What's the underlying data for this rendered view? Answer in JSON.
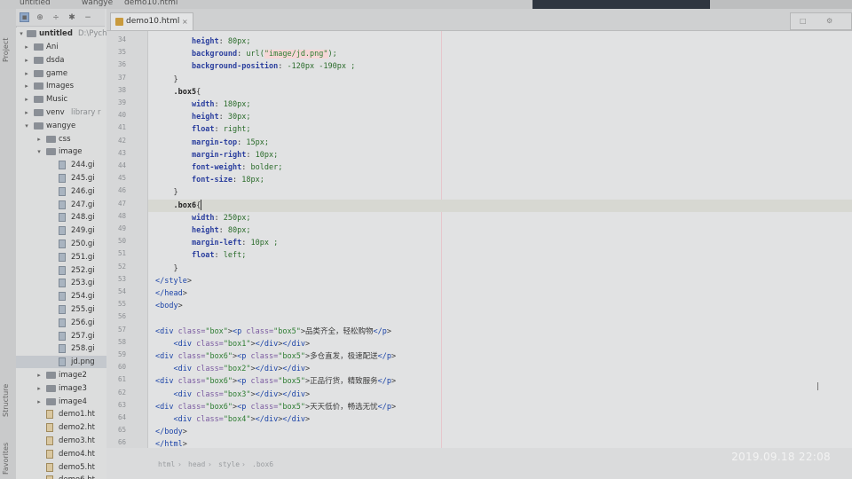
{
  "window": {
    "top_left_project_label": "untitled",
    "top_breadcrumb_folder": "wangye",
    "top_breadcrumb_file": "demo10.html"
  },
  "toolbar": {
    "icons": [
      "project-view-icon",
      "settings-icon",
      "collapse-icon",
      "gear-icon",
      "minimize-icon"
    ]
  },
  "tree": {
    "root_label": "untitled",
    "root_path": "D:\\Pych",
    "items": [
      {
        "label": "Ani",
        "type": "folder"
      },
      {
        "label": "dsda",
        "type": "folder"
      },
      {
        "label": "game",
        "type": "folder"
      },
      {
        "label": "Images",
        "type": "folder"
      },
      {
        "label": "Music",
        "type": "folder"
      },
      {
        "label": "venv",
        "suffix": "library r",
        "type": "folder"
      },
      {
        "label": "wangye",
        "type": "folder"
      },
      {
        "label": "css",
        "type": "folder"
      },
      {
        "label": "image",
        "type": "folder"
      },
      {
        "label": "244.gi",
        "type": "file"
      },
      {
        "label": "245.gi",
        "type": "file"
      },
      {
        "label": "246.gi",
        "type": "file"
      },
      {
        "label": "247.gi",
        "type": "file"
      },
      {
        "label": "248.gi",
        "type": "file"
      },
      {
        "label": "249.gi",
        "type": "file"
      },
      {
        "label": "250.gi",
        "type": "file"
      },
      {
        "label": "251.gi",
        "type": "file"
      },
      {
        "label": "252.gi",
        "type": "file"
      },
      {
        "label": "253.gi",
        "type": "file"
      },
      {
        "label": "254.gi",
        "type": "file"
      },
      {
        "label": "255.gi",
        "type": "file"
      },
      {
        "label": "256.gi",
        "type": "file"
      },
      {
        "label": "257.gi",
        "type": "file"
      },
      {
        "label": "258.gi",
        "type": "file"
      },
      {
        "label": "jd.png",
        "type": "file"
      },
      {
        "label": "image2",
        "type": "folder"
      },
      {
        "label": "image3",
        "type": "folder"
      },
      {
        "label": "image4",
        "type": "folder"
      },
      {
        "label": "demo1.ht",
        "type": "html"
      },
      {
        "label": "demo2.ht",
        "type": "html"
      },
      {
        "label": "demo3.ht",
        "type": "html"
      },
      {
        "label": "demo4.ht",
        "type": "html"
      },
      {
        "label": "demo5.ht",
        "type": "html"
      },
      {
        "label": "demo6.ht",
        "type": "html"
      }
    ]
  },
  "sidebar_vertical_labels": [
    "Project",
    "Structure",
    "Favorites"
  ],
  "tab": {
    "label": "demo10.html",
    "close": "×"
  },
  "code": {
    "line_numbers": [
      "34",
      "35",
      "36",
      "37",
      "38",
      "39",
      "40",
      "41",
      "42",
      "43",
      "44",
      "45",
      "46",
      "47",
      "48",
      "49",
      "50",
      "51",
      "52",
      "53",
      "54",
      "55",
      "56",
      "57",
      "58",
      "59",
      "60",
      "61",
      "62",
      "63",
      "64",
      "65",
      "66"
    ],
    "lines": [
      "        height: 80px;",
      "        background: url(\"image/jd.png\");",
      "        background-position: -120px -190px ;",
      "    }",
      "    .box5{",
      "        width: 180px;",
      "        height: 30px;",
      "        float: right;",
      "        margin-top: 15px;",
      "        margin-right: 10px;",
      "        font-weight: bolder;",
      "        font-size: 18px;",
      "    }",
      "    .box6{",
      "        width: 250px;",
      "        height: 80px;",
      "        margin-left: 10px ;",
      "        float: left;",
      "    }",
      "</style>",
      "</head>",
      "<body>",
      "",
      "<div class=\"box\"><p class=\"box5\">品类齐全，轻松购物</p>",
      "    <div class=\"box1\"></div></div>",
      "<div class=\"box6\"><p class=\"box5\">多仓直发，极速配送</p>",
      "    <div class=\"box2\"></div></div>",
      "<div class=\"box6\"><p class=\"box5\">正品行货，精致服务</p>",
      "    <div class=\"box3\"></div></div>",
      "<div class=\"box6\"><p class=\"box5\">天天低价，畅选无忧</p>",
      "    <div class=\"box4\"></div></div>",
      "</body>",
      "</html>"
    ]
  },
  "breadcrumb": [
    "html",
    "head",
    "style",
    ".box6"
  ],
  "timestamp": "2019.09.18 22:08"
}
